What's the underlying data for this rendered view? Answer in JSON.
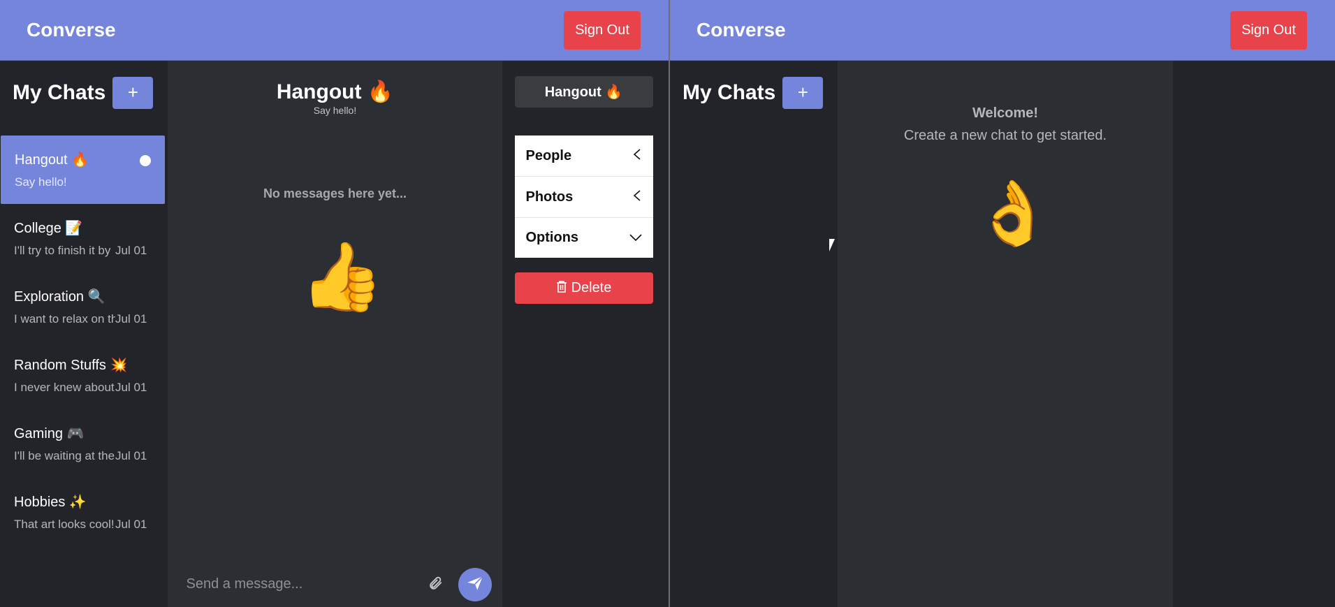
{
  "left": {
    "header": {
      "brand": "Converse",
      "signout_label": "Sign Out"
    },
    "sidebar": {
      "title": "My Chats",
      "add_label": "+",
      "chats": [
        {
          "name": "Hangout 🔥",
          "preview": "Say hello!",
          "time": ""
        },
        {
          "name": "College 📝",
          "preview": "I'll try to finish it by",
          "time": "Jul 01"
        },
        {
          "name": "Exploration 🔍",
          "preview": "I want to relax on th",
          "time": "Jul 01"
        },
        {
          "name": "Random Stuffs 💥",
          "preview": "I never knew about",
          "time": "Jul 01"
        },
        {
          "name": "Gaming 🎮",
          "preview": "I'll be waiting at the",
          "time": "Jul 01"
        },
        {
          "name": "Hobbies ✨",
          "preview": "That art looks cool!",
          "time": "Jul 01"
        }
      ]
    },
    "feed": {
      "title": "Hangout 🔥",
      "subtitle": "Say hello!",
      "empty_text": "No messages here yet...",
      "emoji": "👍",
      "message_placeholder": "Send a message..."
    },
    "settings": {
      "title": "Hangout 🔥",
      "sections": [
        "People",
        "Photos",
        "Options"
      ],
      "delete_label": "Delete"
    }
  },
  "right": {
    "header": {
      "brand": "Converse",
      "signout_label": "Sign Out"
    },
    "sidebar": {
      "title": "My Chats",
      "add_label": "+"
    },
    "welcome": {
      "title": "Welcome!",
      "subtitle": "Create a new chat to get started.",
      "emoji": "👌"
    }
  },
  "icons": {
    "attach": "paperclip-icon",
    "send": "send-icon",
    "chevron_left": "chevron-left-icon",
    "chevron_down": "chevron-down-icon",
    "trash": "trash-icon",
    "cursor": "mouse-cursor-icon",
    "unread": "unread-dot-icon"
  },
  "colors": {
    "accent": "#7585dc",
    "danger": "#e8424b",
    "background": "#2b2e33",
    "sidebar": "#222429"
  }
}
